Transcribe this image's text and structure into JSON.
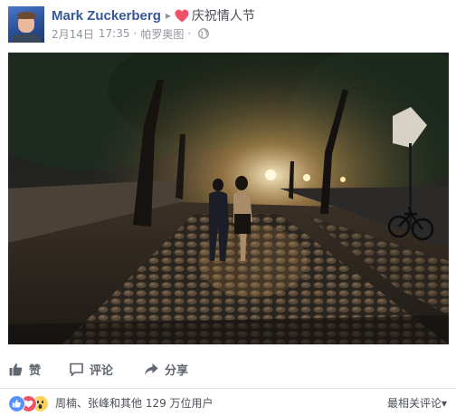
{
  "post": {
    "author": "Mark Zuckerberg",
    "separator": "▸",
    "activity_icon": "heart-icon",
    "activity": "庆祝情人节",
    "date": "2月14日",
    "time": "17:35",
    "dot": "·",
    "location": "帕罗奥图",
    "privacy_icon": "globe-icon"
  },
  "photo": {
    "icon": "photo-night-walk"
  },
  "actions": {
    "like_label": "赞",
    "comment_label": "评论",
    "share_label": "分享"
  },
  "reactions": {
    "icons": [
      "like-reaction-icon",
      "love-reaction-icon",
      "wow-reaction-icon"
    ],
    "summary": "周楠、张峰和其他 129 万位用户",
    "sort_label": "最相关评论",
    "sort_arrow": "▾"
  },
  "colors": {
    "author": "#365899",
    "like_blue": "#5890ff",
    "love_red": "#f25268",
    "wow_yellow": "#fcd05b",
    "muted": "#90949c"
  }
}
